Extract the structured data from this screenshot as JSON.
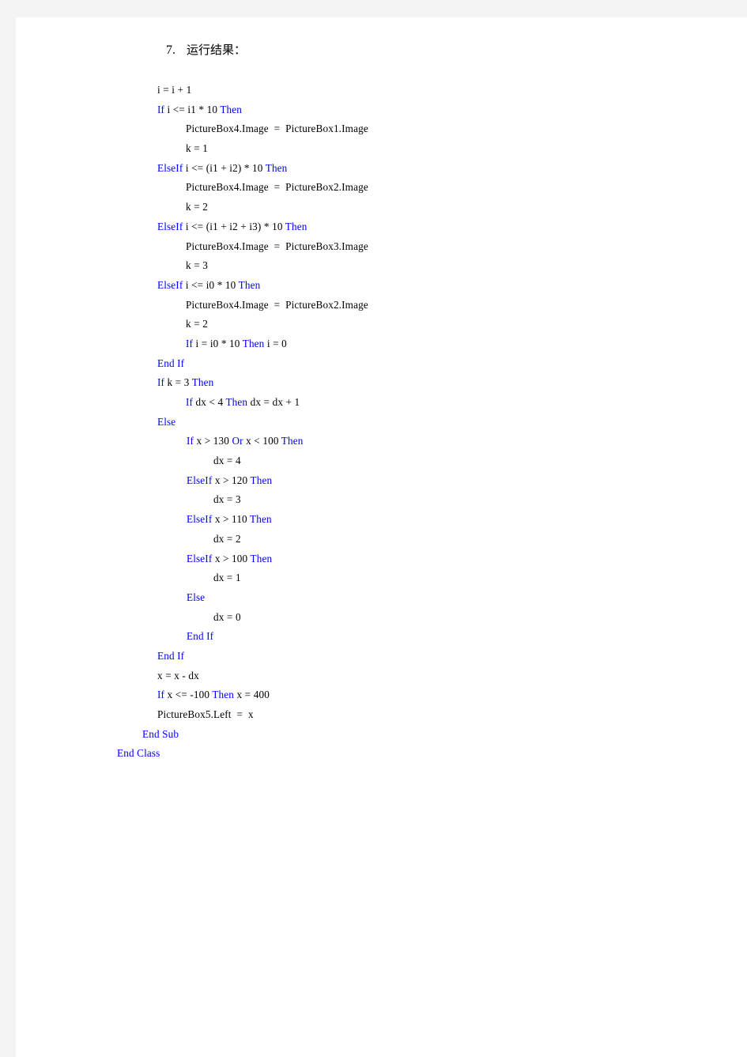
{
  "document": {
    "type": "code-listing-document",
    "language": "Visual Basic .NET",
    "colors": {
      "keyword": "#0000FF",
      "identifier": "#000000",
      "page_background": "#FFFFFF",
      "margin_background": "#F4F4F4"
    }
  },
  "code": {
    "lines": [
      {
        "indent": 0,
        "tokens": [
          {
            "t": "i = i + 1",
            "c": "id"
          }
        ]
      },
      {
        "indent": 0,
        "tokens": [
          {
            "t": "If",
            "c": "kw"
          },
          {
            "t": " i <= i1 * 10 ",
            "c": "id"
          },
          {
            "t": "Then",
            "c": "kw"
          }
        ]
      },
      {
        "indent": 1,
        "tokens": [
          {
            "t": "PictureBox4.Image  =  PictureBox1.Image",
            "c": "id"
          }
        ]
      },
      {
        "indent": 1,
        "tokens": [
          {
            "t": "k = 1",
            "c": "id"
          }
        ]
      },
      {
        "indent": 0,
        "tokens": [
          {
            "t": "ElseIf",
            "c": "kw"
          },
          {
            "t": " i <= (i1 + i2) * 10 ",
            "c": "id"
          },
          {
            "t": "Then",
            "c": "kw"
          }
        ]
      },
      {
        "indent": 1,
        "tokens": [
          {
            "t": "PictureBox4.Image  =  PictureBox2.Image",
            "c": "id"
          }
        ]
      },
      {
        "indent": 1,
        "tokens": [
          {
            "t": "k = 2",
            "c": "id"
          }
        ]
      },
      {
        "indent": 0,
        "tokens": [
          {
            "t": "ElseIf",
            "c": "kw"
          },
          {
            "t": " i <= (i1 + i2 + i3) * 10 ",
            "c": "id"
          },
          {
            "t": "Then",
            "c": "kw"
          }
        ]
      },
      {
        "indent": 1,
        "tokens": [
          {
            "t": "PictureBox4.Image  =  PictureBox3.Image",
            "c": "id"
          }
        ]
      },
      {
        "indent": 1,
        "tokens": [
          {
            "t": "k = 3",
            "c": "id"
          }
        ]
      },
      {
        "indent": 0,
        "tokens": [
          {
            "t": "ElseIf",
            "c": "kw"
          },
          {
            "t": " i <= i0 * 10 ",
            "c": "id"
          },
          {
            "t": "Then",
            "c": "kw"
          }
        ]
      },
      {
        "indent": 1,
        "tokens": [
          {
            "t": "PictureBox4.Image  =  PictureBox2.Image",
            "c": "id"
          }
        ]
      },
      {
        "indent": 1,
        "tokens": [
          {
            "t": "k = 2",
            "c": "id"
          }
        ]
      },
      {
        "indent": 1,
        "tokens": [
          {
            "t": "If",
            "c": "kw"
          },
          {
            "t": " i = i0 * 10 ",
            "c": "id"
          },
          {
            "t": "Then",
            "c": "kw"
          },
          {
            "t": " i = 0",
            "c": "id"
          }
        ]
      },
      {
        "indent": 0,
        "tokens": [
          {
            "t": "End If",
            "c": "kw"
          }
        ]
      },
      {
        "indent": 0,
        "tokens": [
          {
            "t": "If",
            "c": "kw"
          },
          {
            "t": " k = 3 ",
            "c": "id"
          },
          {
            "t": "Then",
            "c": "kw"
          }
        ]
      },
      {
        "indent": 1,
        "tokens": [
          {
            "t": "If",
            "c": "kw"
          },
          {
            "t": " dx < 4 ",
            "c": "id"
          },
          {
            "t": "Then",
            "c": "kw"
          },
          {
            "t": " dx = dx + 1",
            "c": "id"
          }
        ]
      },
      {
        "indent": 0,
        "tokens": [
          {
            "t": "Else",
            "c": "kw"
          }
        ]
      },
      {
        "indent": 2,
        "tokens": [
          {
            "t": "If",
            "c": "kw"
          },
          {
            "t": " x > 130 ",
            "c": "id"
          },
          {
            "t": "Or",
            "c": "kw"
          },
          {
            "t": " x < 100 ",
            "c": "id"
          },
          {
            "t": "Then",
            "c": "kw"
          }
        ]
      },
      {
        "indent": 3,
        "tokens": [
          {
            "t": "dx = 4",
            "c": "id"
          }
        ]
      },
      {
        "indent": 2,
        "tokens": [
          {
            "t": "ElseIf",
            "c": "kw"
          },
          {
            "t": " x > 120 ",
            "c": "id"
          },
          {
            "t": "Then",
            "c": "kw"
          }
        ]
      },
      {
        "indent": 3,
        "tokens": [
          {
            "t": "dx = 3",
            "c": "id"
          }
        ]
      },
      {
        "indent": 2,
        "tokens": [
          {
            "t": "ElseIf",
            "c": "kw"
          },
          {
            "t": " x > 110 ",
            "c": "id"
          },
          {
            "t": "Then",
            "c": "kw"
          }
        ]
      },
      {
        "indent": 3,
        "tokens": [
          {
            "t": "dx = 2",
            "c": "id"
          }
        ]
      },
      {
        "indent": 2,
        "tokens": [
          {
            "t": "ElseIf",
            "c": "kw"
          },
          {
            "t": " x > 100 ",
            "c": "id"
          },
          {
            "t": "Then",
            "c": "kw"
          }
        ]
      },
      {
        "indent": 3,
        "tokens": [
          {
            "t": "dx = 1",
            "c": "id"
          }
        ]
      },
      {
        "indent": 2,
        "tokens": [
          {
            "t": "Else",
            "c": "kw"
          }
        ]
      },
      {
        "indent": 3,
        "tokens": [
          {
            "t": "dx = 0",
            "c": "id"
          }
        ]
      },
      {
        "indent": 2,
        "tokens": [
          {
            "t": "End If",
            "c": "kw"
          }
        ]
      },
      {
        "indent": 0,
        "tokens": [
          {
            "t": "End If",
            "c": "kw"
          }
        ]
      },
      {
        "indent": 0,
        "tokens": [
          {
            "t": "x = x - dx",
            "c": "id"
          }
        ]
      },
      {
        "indent": 0,
        "tokens": [
          {
            "t": "If",
            "c": "kw"
          },
          {
            "t": " x <= -100 ",
            "c": "id"
          },
          {
            "t": "Then",
            "c": "kw"
          },
          {
            "t": " x = 400",
            "c": "id"
          }
        ]
      },
      {
        "indent": 0,
        "tokens": [
          {
            "t": "PictureBox5.Left  =  x",
            "c": "id"
          }
        ]
      },
      {
        "indent": -1,
        "tokens": [
          {
            "t": "End Sub",
            "c": "kw"
          }
        ]
      },
      {
        "indent": -2,
        "tokens": [
          {
            "t": "End Class",
            "c": "kw"
          }
        ]
      }
    ]
  },
  "result_heading": {
    "number": "7.",
    "label": "运行结果："
  }
}
